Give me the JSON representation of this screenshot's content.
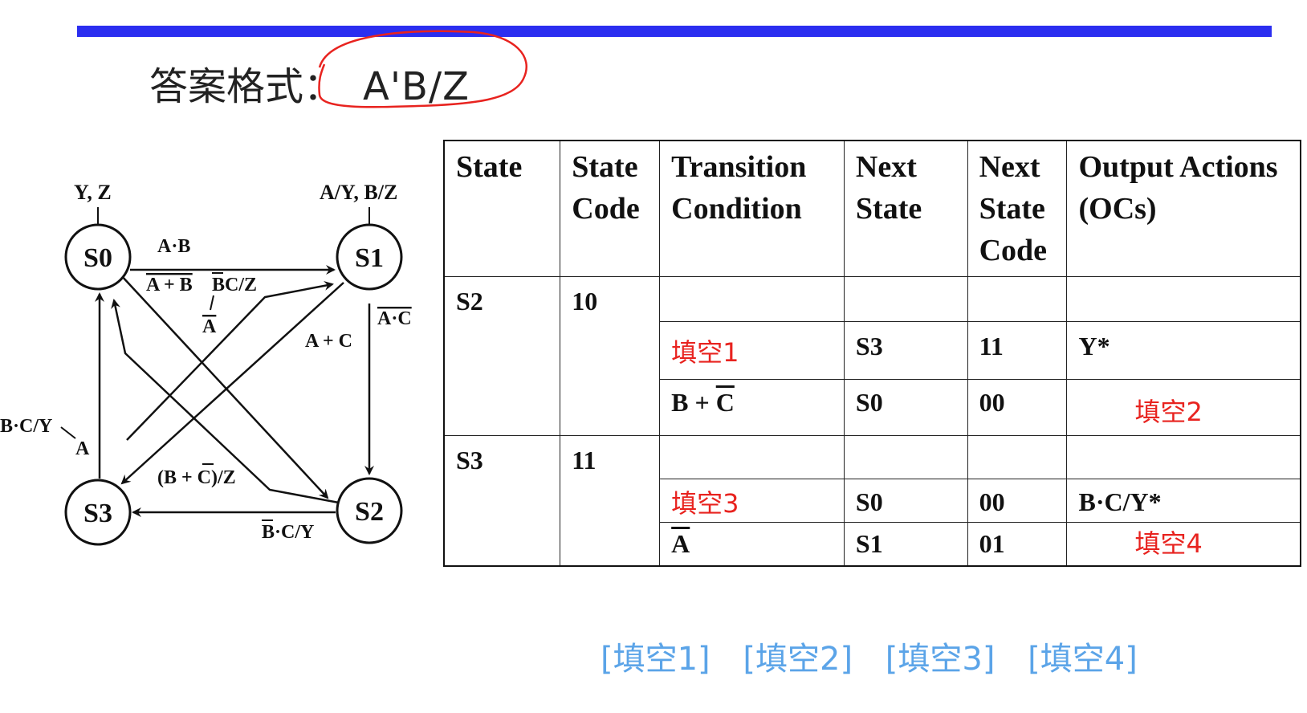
{
  "header": {
    "label": "答案格式：",
    "format": "A'B/Z",
    "bar_color": "#2b2ef0",
    "highlight_color": "#e8231f"
  },
  "diagram": {
    "states": [
      "S0",
      "S1",
      "S2",
      "S3"
    ],
    "outputs": {
      "s0": "Y, Z",
      "s1": "A/Y, B/Z"
    },
    "labels": {
      "s0_s1": "A·B",
      "s0_self": "A + B",
      "s1_s3": "BC/Z",
      "s1_s3_a": "A",
      "s1_s2": "A·C",
      "s1_s3_b": "A + C",
      "s3_s0": "B·C/Y",
      "s3_s0_a": "A",
      "s2_s3": "(B + C)/Z",
      "s2_s3_b": "B·C/Y"
    }
  },
  "table": {
    "headers": [
      "State",
      "State Code",
      "Transition Condition",
      "Next State",
      "Next State Code",
      "Output Actions (OCs)"
    ],
    "groups": [
      {
        "state": "S2",
        "code": "10",
        "rows": [
          {
            "cond": "",
            "next": "",
            "next_code": "",
            "output": ""
          },
          {
            "cond": "填空1",
            "next": "S3",
            "next_code": "11",
            "output": "Y*"
          },
          {
            "cond": "B + C",
            "next": "S0",
            "next_code": "00",
            "output": "填空2"
          }
        ]
      },
      {
        "state": "S3",
        "code": "11",
        "rows": [
          {
            "cond": "",
            "next": "",
            "next_code": "",
            "output": ""
          },
          {
            "cond": "填空3",
            "next": "S0",
            "next_code": "00",
            "output": "B·C/Y*"
          },
          {
            "cond": "A",
            "next": "S1",
            "next_code": "01",
            "output": "填空4"
          }
        ]
      }
    ]
  },
  "blanks": [
    "[填空1]",
    "[填空2]",
    "[填空3]",
    "[填空4]"
  ],
  "blank_color": "#5ba4e8"
}
